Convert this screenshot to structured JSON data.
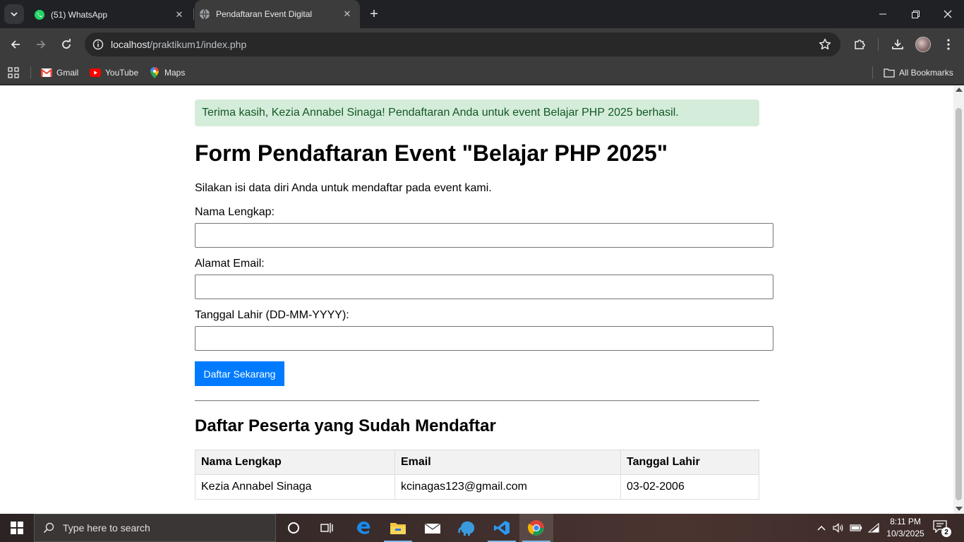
{
  "browser": {
    "tabs": [
      {
        "title": "(51) WhatsApp",
        "active": false,
        "icon": "whatsapp-icon"
      },
      {
        "title": "Pendaftaran Event Digital",
        "active": true,
        "icon": "globe-icon"
      }
    ],
    "url_host": "localhost",
    "url_path": "/praktikum1/index.php",
    "bookmarks": [
      {
        "label": "Gmail",
        "icon": "gmail-icon"
      },
      {
        "label": "YouTube",
        "icon": "youtube-icon"
      },
      {
        "label": "Maps",
        "icon": "maps-icon"
      }
    ],
    "all_bookmarks": "All Bookmarks"
  },
  "page": {
    "alert": "Terima kasih, Kezia Annabel Sinaga! Pendaftaran Anda untuk event Belajar PHP 2025 berhasil.",
    "title": "Form Pendaftaran Event \"Belajar PHP 2025\"",
    "intro": "Silakan isi data diri Anda untuk mendaftar pada event kami.",
    "form": {
      "name_label": "Nama Lengkap:",
      "name_value": "",
      "email_label": "Alamat Email:",
      "email_value": "",
      "dob_label": "Tanggal Lahir (DD-MM-YYYY):",
      "dob_value": "",
      "submit_label": "Daftar Sekarang"
    },
    "participants_title": "Daftar Peserta yang Sudah Mendaftar",
    "table": {
      "headers": [
        "Nama Lengkap",
        "Email",
        "Tanggal Lahir"
      ],
      "rows": [
        [
          "Kezia Annabel Sinaga",
          "kcinagas123@gmail.com",
          "03-02-2006"
        ]
      ]
    }
  },
  "taskbar": {
    "search_placeholder": "Type here to search",
    "time": "8:11 PM",
    "date": "10/3/2025",
    "notification_count": "2"
  },
  "colors": {
    "alert_bg": "#d4edda",
    "alert_text": "#155724",
    "button": "#007bff"
  }
}
